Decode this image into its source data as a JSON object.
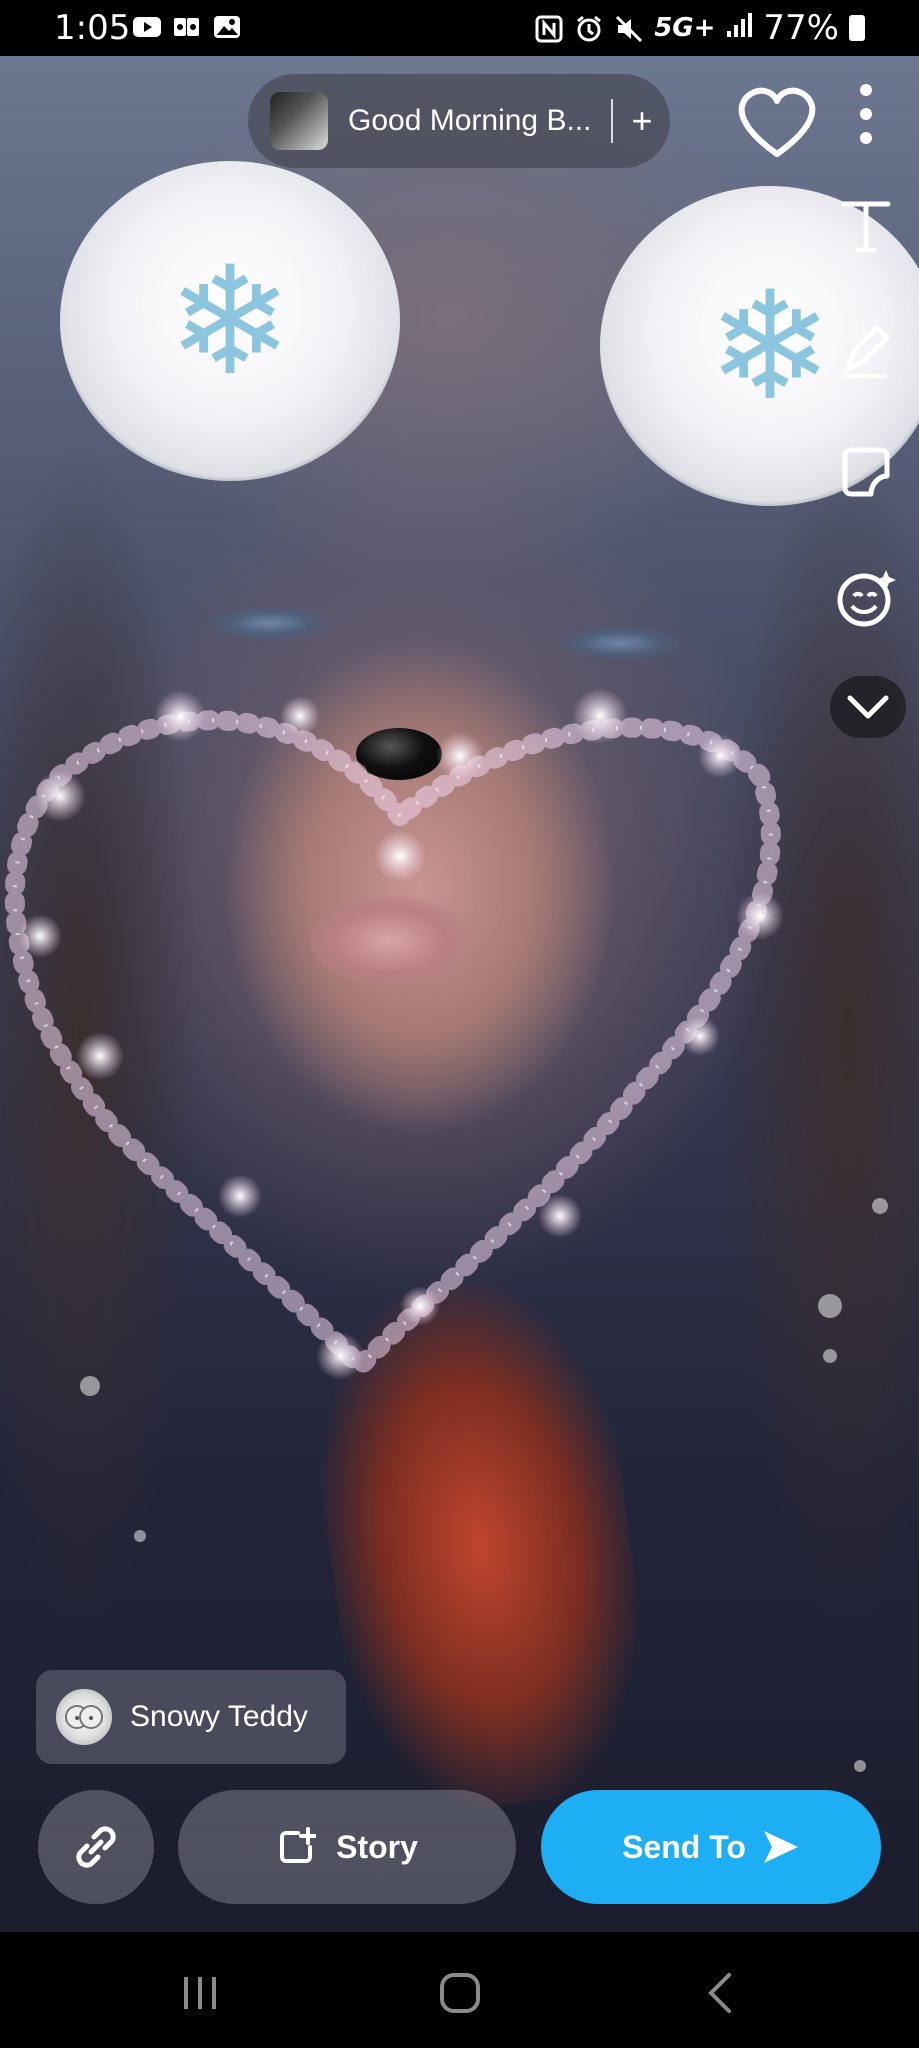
{
  "status_bar": {
    "time": "1:05",
    "left_icons": [
      "youtube-icon",
      "games-icon",
      "gallery-icon"
    ],
    "right_icons": [
      "nfc-icon",
      "alarm-icon",
      "mute-icon"
    ],
    "network": "5G+",
    "battery": "77%"
  },
  "sound": {
    "title": "Good Morning B...",
    "add_symbol": "+"
  },
  "toolbar": {
    "icons": [
      "heart-icon",
      "more-icon",
      "text-icon",
      "pencil-icon",
      "sticker-icon",
      "emoji-sparkle-icon",
      "chevron-down-icon"
    ]
  },
  "lens": {
    "name": "Snowy Teddy"
  },
  "actions": {
    "story_label": "Story",
    "send_label": "Send To"
  },
  "colors": {
    "send_button": "#1eaef3",
    "status_bar": "#000000"
  }
}
